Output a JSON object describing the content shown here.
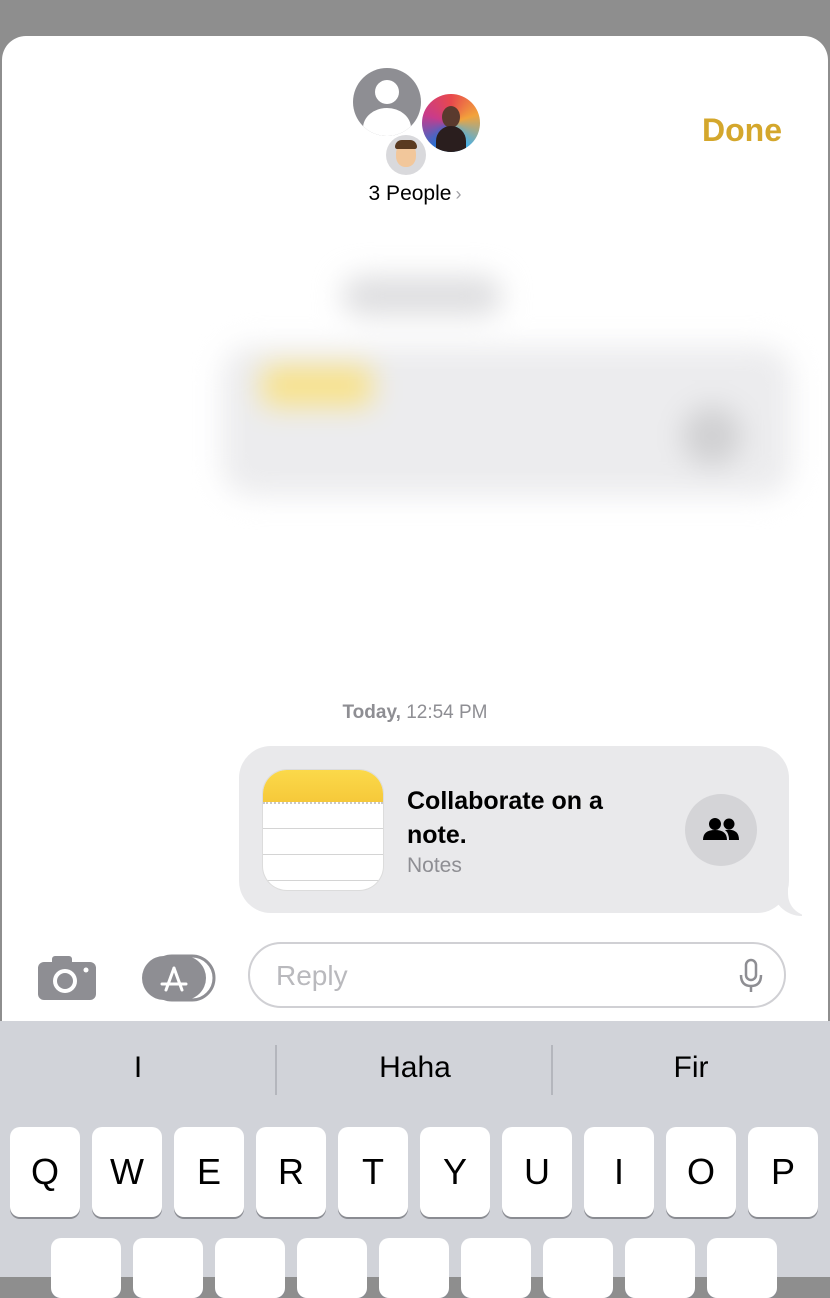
{
  "header": {
    "group_label": "3 People",
    "done_label": "Done"
  },
  "timestamp": {
    "day": "Today,",
    "time": "12:54 PM"
  },
  "message": {
    "title": "Collaborate on a note.",
    "subtitle": "Notes"
  },
  "input": {
    "placeholder": "Reply"
  },
  "keyboard": {
    "suggestions": [
      "I",
      "Haha",
      "Fir"
    ],
    "row1": [
      "Q",
      "W",
      "E",
      "R",
      "T",
      "Y",
      "U",
      "I",
      "O",
      "P"
    ]
  },
  "colors": {
    "accent": "#d4a72c",
    "bubble": "#e9e9eb",
    "keyboard_bg": "#d1d3d9"
  },
  "icons": [
    "camera-icon",
    "app-store-icon",
    "microphone-icon",
    "people-icon",
    "notes-app-icon",
    "chevron-right-icon"
  ]
}
